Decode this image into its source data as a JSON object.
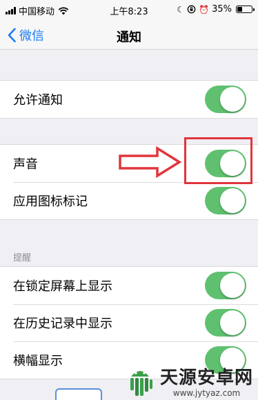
{
  "status_bar": {
    "carrier": "中国移动",
    "time": "上午8:23",
    "battery_percent": "35%",
    "battery_level": 0.35
  },
  "nav": {
    "back_label": "微信",
    "title": "通知"
  },
  "sections": {
    "allow": {
      "label": "允许通知",
      "enabled": true
    },
    "sound_group": [
      {
        "label": "声音",
        "enabled": true
      },
      {
        "label": "应用图标标记",
        "enabled": true
      }
    ],
    "alerts_header": "提醒",
    "alerts": [
      {
        "label": "在锁定屏幕上显示",
        "enabled": true
      },
      {
        "label": "在历史记录中显示",
        "enabled": true
      },
      {
        "label": "横幅显示",
        "enabled": true
      }
    ]
  },
  "watermark": {
    "name": "天源安卓网",
    "url": "www.jytyaz.com"
  },
  "colors": {
    "toggle_on": "#5fc16f",
    "ios_blue": "#1a7cf2",
    "annotation_red": "#e0353c"
  }
}
